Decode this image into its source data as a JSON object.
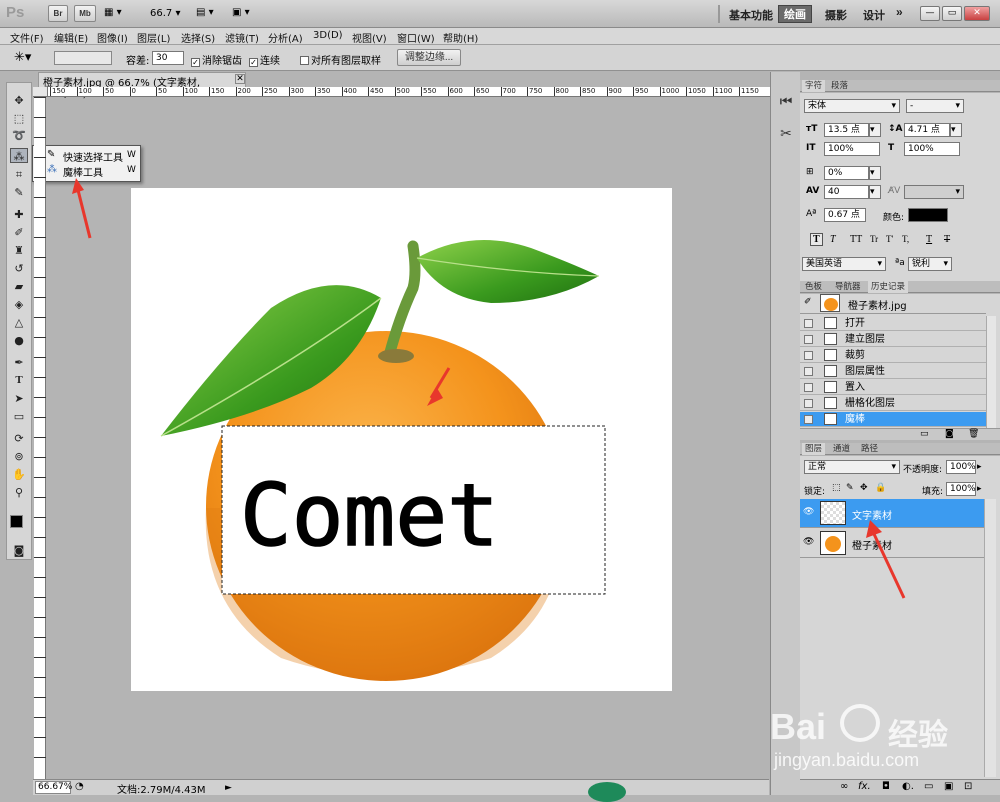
{
  "app": {
    "logo": "Ps",
    "bar_buttons": [
      "Br",
      "Mb"
    ],
    "zoom_dropdown": "66.7",
    "workspaces": [
      "基本功能",
      "绘画",
      "摄影",
      "设计"
    ],
    "active_workspace": "绘画",
    "more": "»"
  },
  "menu": [
    "文件(F)",
    "编辑(E)",
    "图像(I)",
    "图层(L)",
    "选择(S)",
    "滤镜(T)",
    "分析(A)",
    "3D(D)",
    "视图(V)",
    "窗口(W)",
    "帮助(H)"
  ],
  "options": {
    "tolerance_label": "容差:",
    "tolerance_value": "30",
    "antialias_label": "消除锯齿",
    "contiguous_label": "连续",
    "sample_all_label": "对所有图层取样",
    "refine_edge_label": "调整边缘..."
  },
  "document": {
    "tab_title": "橙子素材.jpg @ 66.7% (文字素材, RGB/8#) *",
    "ruler_h": [
      "150",
      "100",
      "50",
      "0",
      "50",
      "100",
      "150",
      "200",
      "250",
      "300",
      "350",
      "400",
      "450",
      "500",
      "550",
      "600",
      "650",
      "700",
      "750",
      "800",
      "850",
      "900",
      "950",
      "1000",
      "1050",
      "1100",
      "1150"
    ],
    "canvas_text": "Comet"
  },
  "flyout": {
    "items": [
      {
        "label": "快速选择工具",
        "key": "W"
      },
      {
        "label": "魔棒工具",
        "key": "W"
      }
    ]
  },
  "status": {
    "zoom": "66.67%",
    "doc_size": "文档:2.79M/4.43M"
  },
  "character": {
    "tabs": [
      "字符",
      "段落"
    ],
    "font_family": "宋体",
    "font_style": "-",
    "font_size": "13.5 点",
    "leading": "4.71 点",
    "vscale": "100%",
    "hscale": "100%",
    "tsume": "0%",
    "tracking": "40",
    "baseline": "0.67 点",
    "color_label": "颜色:",
    "style_buttons": [
      "T",
      "T",
      "TT",
      "Tr",
      "T'",
      "T,",
      "T",
      "T"
    ],
    "language": "美国英语",
    "aa_label": "ªa",
    "antialias": "锐利"
  },
  "history": {
    "tabs": [
      "色板",
      "导航器",
      "历史记录"
    ],
    "snapshot": "橙子素材.jpg",
    "items": [
      "打开",
      "建立图层",
      "裁剪",
      "图层属性",
      "置入",
      "栅格化图层",
      "魔棒"
    ],
    "active": "魔棒"
  },
  "layers": {
    "tabs": [
      "图层",
      "通道",
      "路径"
    ],
    "blend_mode": "正常",
    "opacity_label": "不透明度:",
    "opacity": "100%",
    "lock_label": "锁定:",
    "fill_label": "填充:",
    "fill": "100%",
    "items": [
      {
        "name": "文字素材",
        "active": true
      },
      {
        "name": "橙子素材",
        "active": false
      }
    ],
    "bottom_icons": [
      "∞",
      "fx.",
      "◘",
      "◐.",
      "▭",
      "▣",
      "⊡"
    ]
  },
  "watermark": {
    "brand": "Bai",
    "brand_cn": "经验",
    "url": "jingyan.baidu.com"
  },
  "colors": {
    "selection_blue": "#3c9bf0",
    "arrow_red": "#e8372c",
    "orange": "#f4931c"
  }
}
